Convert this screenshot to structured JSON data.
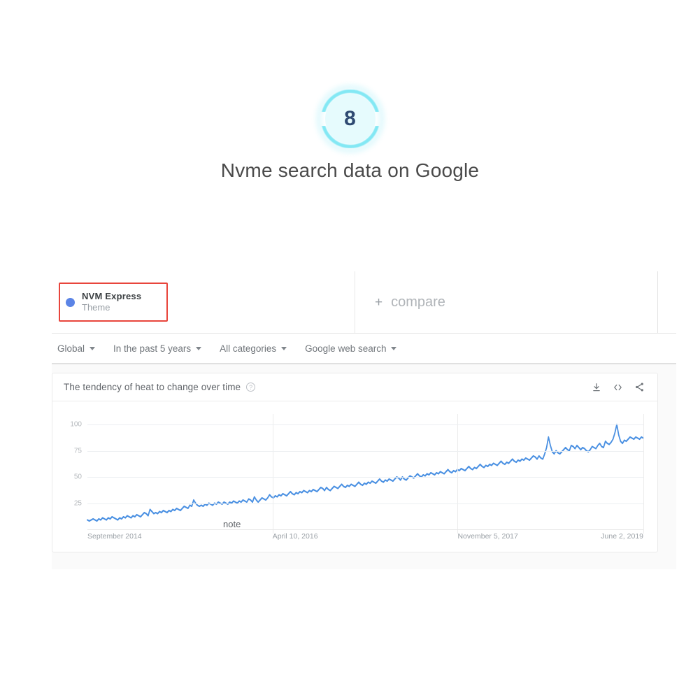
{
  "badge": {
    "number": "8",
    "ring_color": "#6fe4f2",
    "fill_color": "#e6fbfd",
    "number_color": "#2f4a72"
  },
  "headline": "Nvme search data on Google",
  "trends": {
    "search_term": {
      "title": "NVM Express",
      "subtitle": "Theme",
      "dot_color": "#5b84e6",
      "highlight_color": "#e8453c"
    },
    "compare": {
      "plus": "+",
      "label": "compare"
    },
    "filters": [
      {
        "label": "Global",
        "icon": "chevron-down-icon"
      },
      {
        "label": "In the past 5 years",
        "icon": "chevron-down-icon"
      },
      {
        "label": "All categories",
        "icon": "chevron-down-icon"
      },
      {
        "label": "Google web search",
        "icon": "chevron-down-icon"
      }
    ],
    "card": {
      "title": "The tendency of heat to change over time",
      "help_icon": "?",
      "actions": [
        {
          "name": "download-icon"
        },
        {
          "name": "embed-code-icon"
        },
        {
          "name": "share-icon"
        }
      ]
    },
    "annotation": "note"
  },
  "chart_data": {
    "type": "line",
    "title": "The tendency of heat to change over time",
    "xlabel": "",
    "ylabel": "",
    "ylim": [
      0,
      110
    ],
    "yticks": [
      100,
      75,
      50,
      25
    ],
    "grid": true,
    "legend": "none",
    "line_color": "#4a90e2",
    "xtick_labels": [
      "September 2014",
      "April 10, 2016",
      "November 5, 2017",
      "June 2, 2019"
    ],
    "xtick_positions": [
      0,
      33.3,
      66.6,
      100
    ],
    "series": [
      {
        "name": "NVM Express",
        "values": [
          9,
          8,
          9,
          10,
          9,
          8,
          10,
          9,
          11,
          10,
          9,
          11,
          10,
          12,
          11,
          10,
          9,
          11,
          10,
          12,
          11,
          13,
          12,
          11,
          13,
          12,
          14,
          13,
          12,
          14,
          16,
          15,
          13,
          19,
          17,
          15,
          16,
          15,
          17,
          16,
          18,
          17,
          16,
          18,
          17,
          19,
          18,
          20,
          19,
          18,
          20,
          22,
          21,
          20,
          23,
          22,
          28,
          25,
          23,
          22,
          23,
          22,
          24,
          23,
          25,
          24,
          23,
          25,
          24,
          26,
          25,
          24,
          26,
          25,
          24,
          26,
          25,
          27,
          26,
          25,
          27,
          26,
          28,
          27,
          26,
          29,
          28,
          26,
          31,
          28,
          26,
          28,
          30,
          29,
          28,
          30,
          33,
          31,
          30,
          32,
          31,
          33,
          32,
          34,
          33,
          32,
          34,
          36,
          34,
          33,
          35,
          34,
          36,
          35,
          37,
          36,
          35,
          37,
          36,
          38,
          37,
          36,
          38,
          40,
          39,
          37,
          40,
          38,
          37,
          39,
          41,
          40,
          39,
          41,
          43,
          41,
          40,
          42,
          41,
          43,
          42,
          41,
          43,
          45,
          43,
          42,
          44,
          43,
          45,
          44,
          46,
          45,
          44,
          46,
          48,
          46,
          45,
          47,
          46,
          48,
          47,
          46,
          48,
          50,
          49,
          47,
          50,
          48,
          47,
          49,
          51,
          50,
          49,
          51,
          53,
          51,
          50,
          52,
          51,
          53,
          52,
          54,
          53,
          52,
          54,
          53,
          55,
          54,
          53,
          55,
          57,
          55,
          54,
          56,
          55,
          57,
          56,
          58,
          57,
          56,
          58,
          60,
          58,
          57,
          59,
          58,
          60,
          62,
          60,
          59,
          61,
          60,
          62,
          61,
          63,
          62,
          61,
          63,
          65,
          63,
          62,
          64,
          63,
          65,
          67,
          65,
          64,
          66,
          65,
          67,
          66,
          68,
          67,
          66,
          68,
          70,
          69,
          67,
          70,
          68,
          67,
          72,
          78,
          88,
          80,
          74,
          72,
          75,
          73,
          72,
          74,
          76,
          78,
          76,
          75,
          80,
          79,
          77,
          80,
          78,
          76,
          78,
          77,
          75,
          74,
          76,
          79,
          78,
          77,
          80,
          82,
          79,
          78,
          84,
          82,
          81,
          83,
          86,
          92,
          100,
          90,
          84,
          82,
          85,
          84,
          86,
          88,
          87,
          86,
          88,
          87,
          86,
          88,
          87
        ]
      }
    ]
  }
}
